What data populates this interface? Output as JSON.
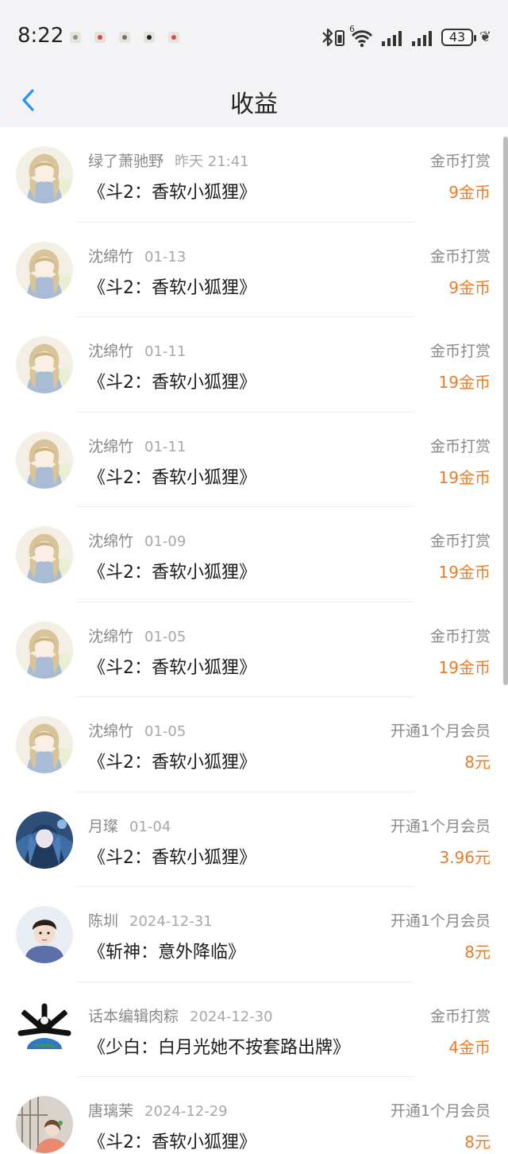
{
  "status_bar": {
    "time": "8:22",
    "battery": "43",
    "network_label": "6"
  },
  "header": {
    "title": "收益",
    "back_icon": "chevron-left-icon"
  },
  "colors": {
    "accent": "#2196f3",
    "amount": "#ee7b25",
    "meta": "#8a8a8a"
  },
  "earnings": [
    {
      "user": "绿了萧驰野",
      "date": "昨天 21:41",
      "book": "《斗2：香软小狐狸》",
      "type": "金币打赏",
      "amount": "9金币",
      "avatar": "anime-girl"
    },
    {
      "user": "沈绵竹",
      "date": "01-13",
      "book": "《斗2：香软小狐狸》",
      "type": "金币打赏",
      "amount": "9金币",
      "avatar": "anime-girl"
    },
    {
      "user": "沈绵竹",
      "date": "01-11",
      "book": "《斗2：香软小狐狸》",
      "type": "金币打赏",
      "amount": "19金币",
      "avatar": "anime-girl"
    },
    {
      "user": "沈绵竹",
      "date": "01-11",
      "book": "《斗2：香软小狐狸》",
      "type": "金币打赏",
      "amount": "19金币",
      "avatar": "anime-girl"
    },
    {
      "user": "沈绵竹",
      "date": "01-09",
      "book": "《斗2：香软小狐狸》",
      "type": "金币打赏",
      "amount": "19金币",
      "avatar": "anime-girl"
    },
    {
      "user": "沈绵竹",
      "date": "01-05",
      "book": "《斗2：香软小狐狸》",
      "type": "金币打赏",
      "amount": "19金币",
      "avatar": "anime-girl"
    },
    {
      "user": "沈绵竹",
      "date": "01-05",
      "book": "《斗2：香软小狐狸》",
      "type": "开通1个月会员",
      "amount": "8元",
      "avatar": "anime-girl"
    },
    {
      "user": "月璨",
      "date": "01-04",
      "book": "《斗2：香软小狐狸》",
      "type": "开通1个月会员",
      "amount": "3.96元",
      "avatar": "blue-hair"
    },
    {
      "user": "陈圳",
      "date": "2024-12-31",
      "book": "《斩神：意外降临》",
      "type": "开通1个月会员",
      "amount": "8元",
      "avatar": "boy-portrait"
    },
    {
      "user": "话本编辑肉粽",
      "date": "2024-12-30",
      "book": "《少白：白月光她不按套路出牌》",
      "type": "金币打赏",
      "amount": "4金币",
      "avatar": "black-cat-globe"
    },
    {
      "user": "唐璃茉",
      "date": "2024-12-29",
      "book": "《斗2：香软小狐狸》",
      "type": "开通1个月会员",
      "amount": "8元",
      "avatar": "window-girl"
    }
  ]
}
